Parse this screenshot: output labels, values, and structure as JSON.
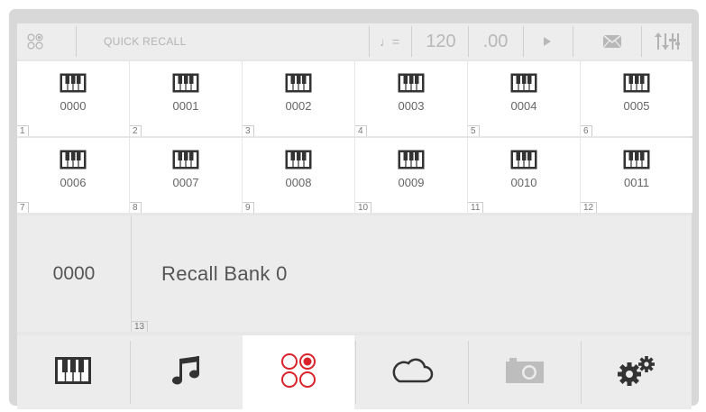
{
  "header": {
    "title": "QUICK RECALL",
    "tempo_symbol": "♩=",
    "tempo": "120",
    "tempo_fraction": ".00",
    "icons": [
      "quick-recall-icon",
      "tempo-icon",
      "play-icon",
      "mail-icon",
      "mixer-icon"
    ]
  },
  "tiles": [
    {
      "code": "0000",
      "index": "1"
    },
    {
      "code": "0001",
      "index": "2"
    },
    {
      "code": "0002",
      "index": "3"
    },
    {
      "code": "0003",
      "index": "4"
    },
    {
      "code": "0004",
      "index": "5"
    },
    {
      "code": "0005",
      "index": "6"
    },
    {
      "code": "0006",
      "index": "7"
    },
    {
      "code": "0007",
      "index": "8"
    },
    {
      "code": "0008",
      "index": "9"
    },
    {
      "code": "0009",
      "index": "10"
    },
    {
      "code": "0010",
      "index": "11"
    },
    {
      "code": "0011",
      "index": "12"
    }
  ],
  "recall": {
    "code": "0000",
    "name": "Recall Bank 0",
    "index": "13"
  },
  "bottom_nav": [
    {
      "icon": "piano-icon",
      "active": false
    },
    {
      "icon": "music-note-icon",
      "active": false
    },
    {
      "icon": "quick-recall-icon",
      "active": true
    },
    {
      "icon": "cloud-icon",
      "active": false
    },
    {
      "icon": "camera-icon",
      "active": false
    },
    {
      "icon": "settings-icon",
      "active": false
    }
  ],
  "colors": {
    "accent": "#d8232a",
    "icon_dark": "#333333",
    "icon_light": "#b8b8b8"
  }
}
